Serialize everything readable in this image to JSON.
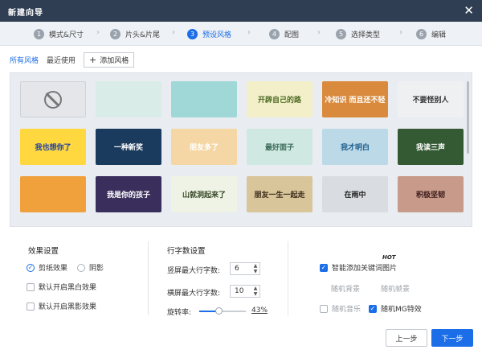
{
  "window": {
    "title": "新建向导"
  },
  "steps": [
    {
      "num": "1",
      "label": "模式&尺寸"
    },
    {
      "num": "2",
      "label": "片头&片尾"
    },
    {
      "num": "3",
      "label": "预设风格"
    },
    {
      "num": "4",
      "label": "配图"
    },
    {
      "num": "5",
      "label": "选择类型"
    },
    {
      "num": "6",
      "label": "编辑"
    }
  ],
  "tabs": {
    "all": "所有风格",
    "recent": "最近使用",
    "add": "添加风格"
  },
  "thumbnails": [
    {
      "text": "",
      "bg": "#e4e6ea",
      "fg": "#777"
    },
    {
      "text": "",
      "bg": "#d9ece7",
      "fg": "#2e5f50"
    },
    {
      "text": "",
      "bg": "#9fd8d7",
      "fg": "#245"
    },
    {
      "text": "开辟自己的路",
      "bg": "#f3f0c9",
      "fg": "#4d6a23"
    },
    {
      "text": "冷知识 而且还不轻",
      "bg": "#d98a3c",
      "fg": "#ffffff"
    },
    {
      "text": "不要怪别人",
      "bg": "#eef0f2",
      "fg": "#333"
    },
    {
      "text": "我也想你了",
      "bg": "#ffd840",
      "fg": "#1d3fa6"
    },
    {
      "text": "一种新奖",
      "bg": "#1a3a5e",
      "fg": "#ffffff"
    },
    {
      "text": "朋友多了",
      "bg": "#f4d7a4",
      "fg": "#ffffff"
    },
    {
      "text": "最好面子",
      "bg": "#cfe8e1",
      "fg": "#3b6b5a"
    },
    {
      "text": "我才明白",
      "bg": "#bcd9e8",
      "fg": "#1d5f8a"
    },
    {
      "text": "我读三声",
      "bg": "#335a33",
      "fg": "#ffffff"
    },
    {
      "text": "",
      "bg": "#f1a13b",
      "fg": "#ffffff"
    },
    {
      "text": "我是你的孩子",
      "bg": "#3a2f5c",
      "fg": "#ffffff"
    },
    {
      "text": "山就洞起来了",
      "bg": "#eef3e5",
      "fg": "#3a4a2a"
    },
    {
      "text": "朋友一生一起走",
      "bg": "#d8c59a",
      "fg": "#3a2a1a"
    },
    {
      "text": "在雨中",
      "bg": "#d9dde2",
      "fg": "#222"
    },
    {
      "text": "积极坚韧",
      "bg": "#c79a8a",
      "fg": "#3a1a1a"
    }
  ],
  "effects": {
    "title": "效果设置",
    "paper_cut": "剪纸效果",
    "shadow": "阴影",
    "white_effect": "默认开启黑白效果",
    "black_shadow": "默认开启黑影效果"
  },
  "line_settings": {
    "title": "行字数设置",
    "portrait_label": "竖屏最大行字数:",
    "portrait_value": "6",
    "landscape_label": "横屏最大行字数:",
    "landscape_value": "10",
    "rotation_label": "旋转率:",
    "rotation_value": "43%",
    "rotation_fraction": 0.43
  },
  "smart": {
    "add_keyword_images": "智能添加关键词图片",
    "hot_badge": "HOT",
    "random_bg": "随机背景",
    "random_frame": "随机帧景",
    "random_music": "随机音乐",
    "random_mg": "随机MG特效"
  },
  "buttons": {
    "prev": "上一步",
    "next": "下一步"
  },
  "colors": {
    "accent": "#1b6ee8",
    "titlebar": "#2f3e52"
  }
}
